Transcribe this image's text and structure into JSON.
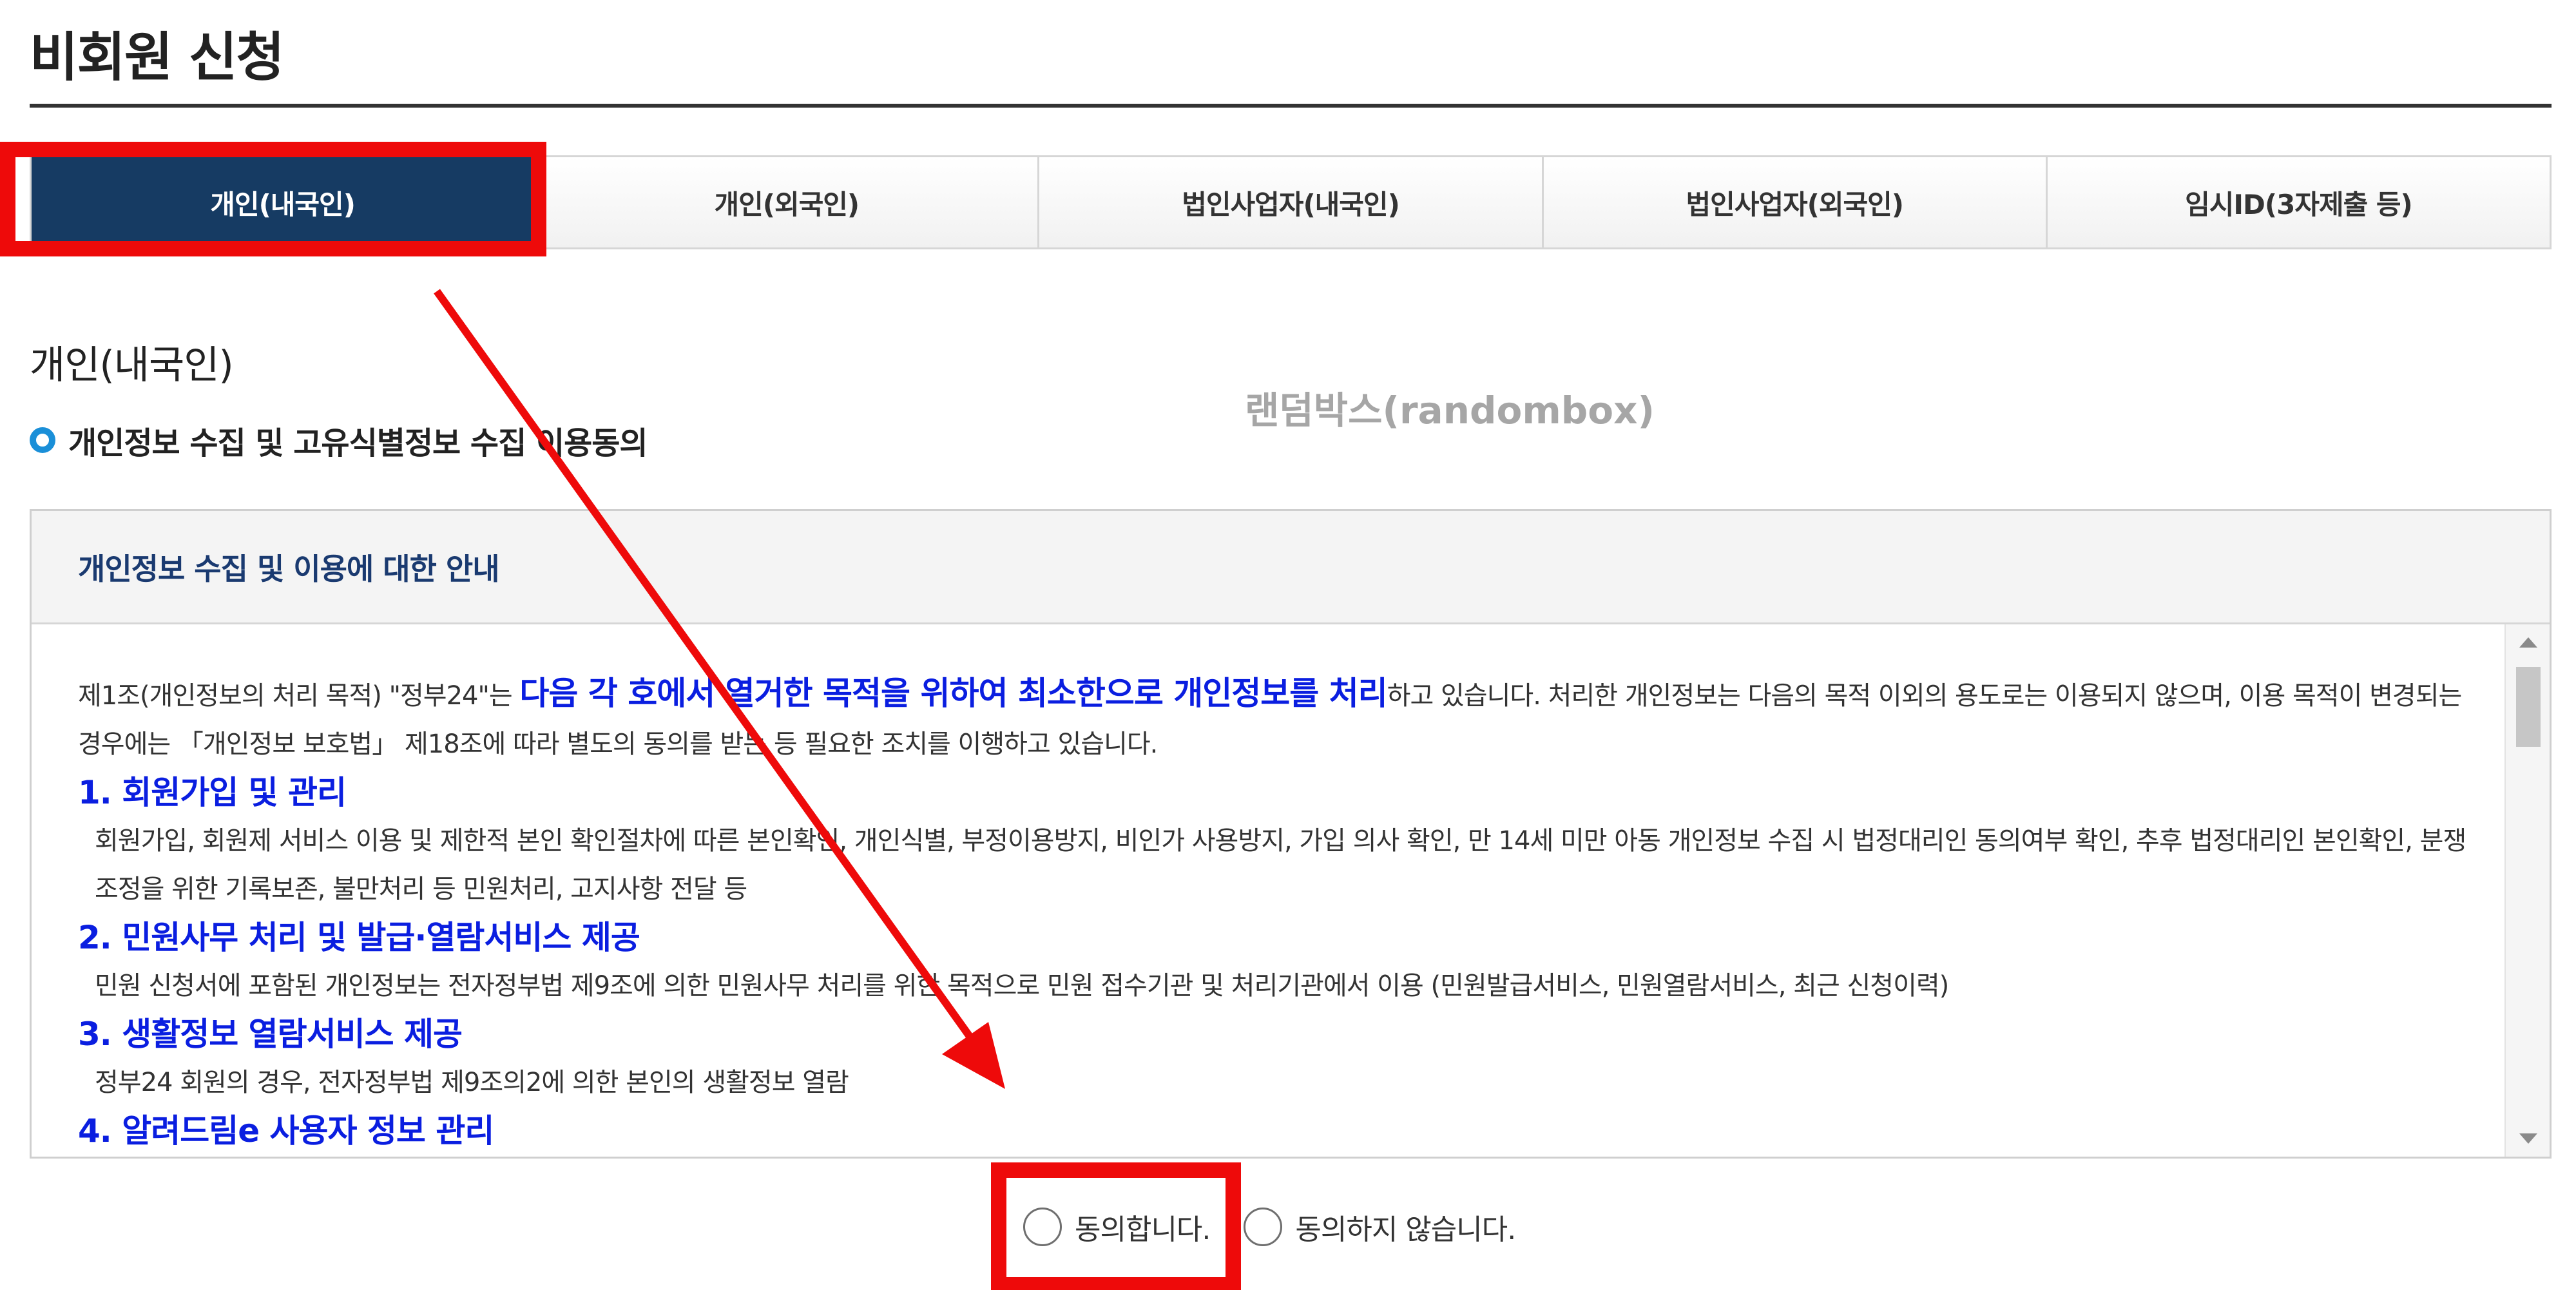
{
  "page_title": "비회원 신청",
  "tabs": [
    {
      "label": "개인(내국인)"
    },
    {
      "label": "개인(외국인)"
    },
    {
      "label": "법인사업자(내국인)"
    },
    {
      "label": "법인사업자(외국인)"
    },
    {
      "label": "임시ID(3자제출 등)"
    }
  ],
  "section_title": "개인(내국인)",
  "sub_title": "개인정보 수집 및 고유식별정보 수집 이용동의",
  "watermark": "랜덤박스(randombox)",
  "notice": {
    "header": "개인정보 수집 및 이용에 대한 안내",
    "intro_pre": "제1조(개인정보의 처리 목적) \"정부24\"는 ",
    "intro_highlight": "다음 각 호에서 열거한 목적을 위하여 최소한으로 개인정보를 처리",
    "intro_post": "하고 있습니다. 처리한 개인정보는 다음의 목적 이외의 용도로는 이용되지 않으며, 이용 목적이 변경되는 경우에는 「개인정보 보호법」 제18조에 따라 별도의 동의를 받는 등 필요한 조치를 이행하고 있습니다.",
    "items": [
      {
        "heading": "1. 회원가입 및 관리",
        "text": "회원가입, 회원제 서비스 이용 및 제한적 본인 확인절차에 따른 본인확인, 개인식별, 부정이용방지, 비인가 사용방지, 가입 의사 확인, 만 14세 미만 아동 개인정보 수집 시 법정대리인 동의여부 확인, 추후 법정대리인 본인확인, 분쟁 조정을 위한 기록보존, 불만처리 등 민원처리, 고지사항 전달 등"
      },
      {
        "heading": "2. 민원사무 처리 및 발급·열람서비스 제공",
        "text": "민원 신청서에 포함된 개인정보는 전자정부법 제9조에 의한 민원사무 처리를 위한 목적으로 민원 접수기관 및 처리기관에서 이용 (민원발급서비스, 민원열람서비스, 최근 신청이력)"
      },
      {
        "heading": "3. 생활정보 열람서비스 제공",
        "text": "정부24 회원의 경우, 전자정부법 제9조의2에 의한 본인의 생활정보 열람"
      },
      {
        "heading": "4. 알려드림e 사용자 정보 관리",
        "text": ""
      }
    ]
  },
  "consent": {
    "agree": "동의합니다.",
    "disagree": "동의하지 않습니다."
  },
  "colors": {
    "active_tab": "#163b63",
    "highlight": "#ee0a0a",
    "link_blue": "#0a1ee0",
    "bullet": "#1a8fd8"
  }
}
